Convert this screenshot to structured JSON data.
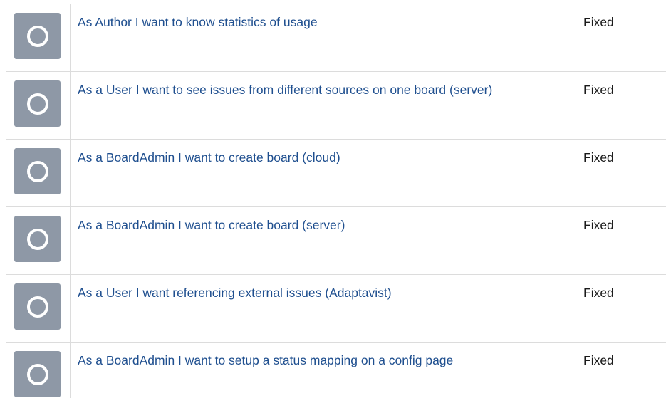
{
  "rows": [
    {
      "icon": "issue-status-circle-icon",
      "summary": "As Author I want to know statistics of usage",
      "status": "Fixed"
    },
    {
      "icon": "issue-status-circle-icon",
      "summary": "As a User I want to see issues from different sources on one board (server)",
      "status": "Fixed"
    },
    {
      "icon": "issue-status-circle-icon",
      "summary": "As a BoardAdmin I want to create board (cloud)",
      "status": "Fixed"
    },
    {
      "icon": "issue-status-circle-icon",
      "summary": "As a BoardAdmin I want to create board (server)",
      "status": "Fixed"
    },
    {
      "icon": "issue-status-circle-icon",
      "summary": "As a User I want referencing external issues (Adaptavist)",
      "status": "Fixed"
    },
    {
      "icon": "issue-status-circle-icon",
      "summary": "As a BoardAdmin I want to setup a status mapping on a config page",
      "status": "Fixed"
    }
  ],
  "colors": {
    "icon_bg": "#8e98a6",
    "link": "#1f4f8f",
    "border": "#dcdcdc"
  }
}
